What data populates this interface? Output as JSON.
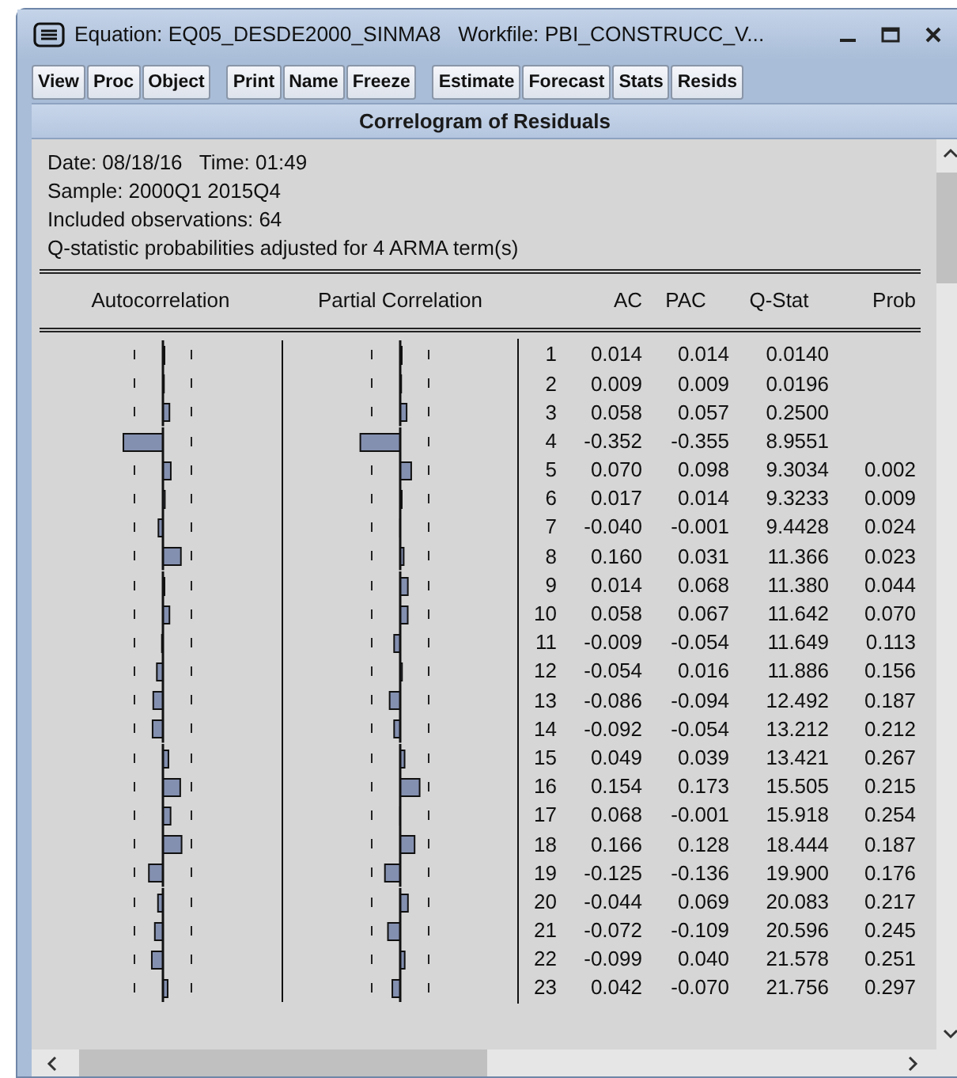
{
  "window": {
    "title": "Equation: EQ05_DESDE2000_SINMA8   Workfile: PBI_CONSTRUCC_V..."
  },
  "toolbar": {
    "groups": [
      [
        "View",
        "Proc",
        "Object"
      ],
      [
        "Print",
        "Name",
        "Freeze"
      ],
      [
        "Estimate",
        "Forecast",
        "Stats",
        "Resids"
      ]
    ]
  },
  "view_title": "Correlogram of Residuals",
  "header_lines": [
    "Date: 08/18/16   Time: 01:49",
    "Sample: 2000Q1 2015Q4",
    "Included observations: 64",
    "Q-statistic probabilities adjusted for 4 ARMA term(s)"
  ],
  "table": {
    "columns": [
      "Autocorrelation",
      "Partial Correlation",
      "AC",
      "PAC",
      "Q-Stat",
      "Prob"
    ],
    "rows": [
      {
        "lag": "1",
        "ac": "0.014",
        "pac": "0.014",
        "q_stat": "0.0140"
      },
      {
        "lag": "2",
        "ac": "0.009",
        "pac": "0.009",
        "q_stat": "0.0196"
      },
      {
        "lag": "3",
        "ac": "0.058",
        "pac": "0.057",
        "q_stat": "0.2500"
      },
      {
        "lag": "4",
        "ac": "-0.352",
        "pac": "-0.355",
        "q_stat": "8.9551"
      },
      {
        "lag": "5",
        "ac": "0.070",
        "pac": "0.098",
        "q_stat": "9.3034",
        "prob": "0.002"
      },
      {
        "lag": "6",
        "ac": "0.017",
        "pac": "0.014",
        "q_stat": "9.3233",
        "prob": "0.009"
      },
      {
        "lag": "7",
        "ac": "-0.040",
        "pac": "-0.001",
        "q_stat": "9.4428",
        "prob": "0.024"
      },
      {
        "lag": "8",
        "ac": "0.160",
        "pac": "0.031",
        "q_stat": "11.366",
        "prob": "0.023"
      },
      {
        "lag": "9",
        "ac": "0.014",
        "pac": "0.068",
        "q_stat": "11.380",
        "prob": "0.044"
      },
      {
        "lag": "10",
        "ac": "0.058",
        "pac": "0.067",
        "q_stat": "11.642",
        "prob": "0.070"
      },
      {
        "lag": "11",
        "ac": "-0.009",
        "pac": "-0.054",
        "q_stat": "11.649",
        "prob": "0.113"
      },
      {
        "lag": "12",
        "ac": "-0.054",
        "pac": "0.016",
        "q_stat": "11.886",
        "prob": "0.156"
      },
      {
        "lag": "13",
        "ac": "-0.086",
        "pac": "-0.094",
        "q_stat": "12.492",
        "prob": "0.187"
      },
      {
        "lag": "14",
        "ac": "-0.092",
        "pac": "-0.054",
        "q_stat": "13.212",
        "prob": "0.212"
      },
      {
        "lag": "15",
        "ac": "0.049",
        "pac": "0.039",
        "q_stat": "13.421",
        "prob": "0.267"
      },
      {
        "lag": "16",
        "ac": "0.154",
        "pac": "0.173",
        "q_stat": "15.505",
        "prob": "0.215"
      },
      {
        "lag": "17",
        "ac": "0.068",
        "pac": "-0.001",
        "q_stat": "15.918",
        "prob": "0.254"
      },
      {
        "lag": "18",
        "ac": "0.166",
        "pac": "0.128",
        "q_stat": "18.444",
        "prob": "0.187"
      },
      {
        "lag": "19",
        "ac": "-0.125",
        "pac": "-0.136",
        "q_stat": "19.900",
        "prob": "0.176"
      },
      {
        "lag": "20",
        "ac": "-0.044",
        "pac": "0.069",
        "q_stat": "20.083",
        "prob": "0.217"
      },
      {
        "lag": "21",
        "ac": "-0.072",
        "pac": "-0.109",
        "q_stat": "20.596",
        "prob": "0.245"
      },
      {
        "lag": "22",
        "ac": "-0.099",
        "pac": "0.040",
        "q_stat": "21.578",
        "prob": "0.251"
      },
      {
        "lag": "23",
        "ac": "0.042",
        "pac": "-0.070",
        "q_stat": "21.756",
        "prob": "0.297"
      }
    ]
  }
}
